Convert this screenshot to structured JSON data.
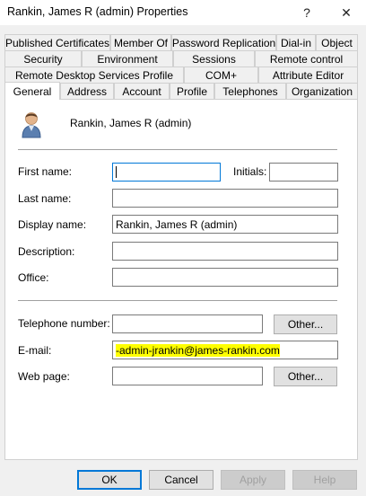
{
  "window": {
    "title": "Rankin, James R (admin) Properties",
    "help_glyph": "?",
    "close_glyph": "✕"
  },
  "tabs": {
    "row1": [
      "Published Certificates",
      "Member Of",
      "Password Replication",
      "Dial-in",
      "Object"
    ],
    "row2": [
      "Security",
      "Environment",
      "Sessions",
      "Remote control"
    ],
    "row3": [
      "Remote Desktop Services Profile",
      "COM+",
      "Attribute Editor"
    ],
    "row4": [
      "General",
      "Address",
      "Account",
      "Profile",
      "Telephones",
      "Organization"
    ],
    "selected": "General"
  },
  "general": {
    "user_display": "Rankin, James R (admin)",
    "fields": {
      "first_name": {
        "label": "First name:",
        "value": ""
      },
      "initials": {
        "label": "Initials:",
        "value": ""
      },
      "last_name": {
        "label": "Last name:",
        "value": ""
      },
      "display_name": {
        "label": "Display name:",
        "value": "Rankin, James R (admin)"
      },
      "description": {
        "label": "Description:",
        "value": ""
      },
      "office": {
        "label": "Office:",
        "value": ""
      },
      "telephone": {
        "label": "Telephone number:",
        "value": ""
      },
      "email": {
        "label": "E-mail:",
        "value": "-admin-jrankin@james-rankin.com"
      },
      "web_page": {
        "label": "Web page:",
        "value": ""
      }
    },
    "other_button_label": "Other..."
  },
  "footer": {
    "ok": "OK",
    "cancel": "Cancel",
    "apply": "Apply",
    "help": "Help"
  },
  "colors": {
    "highlight": "#ffff00",
    "focus_border": "#0078d7"
  }
}
